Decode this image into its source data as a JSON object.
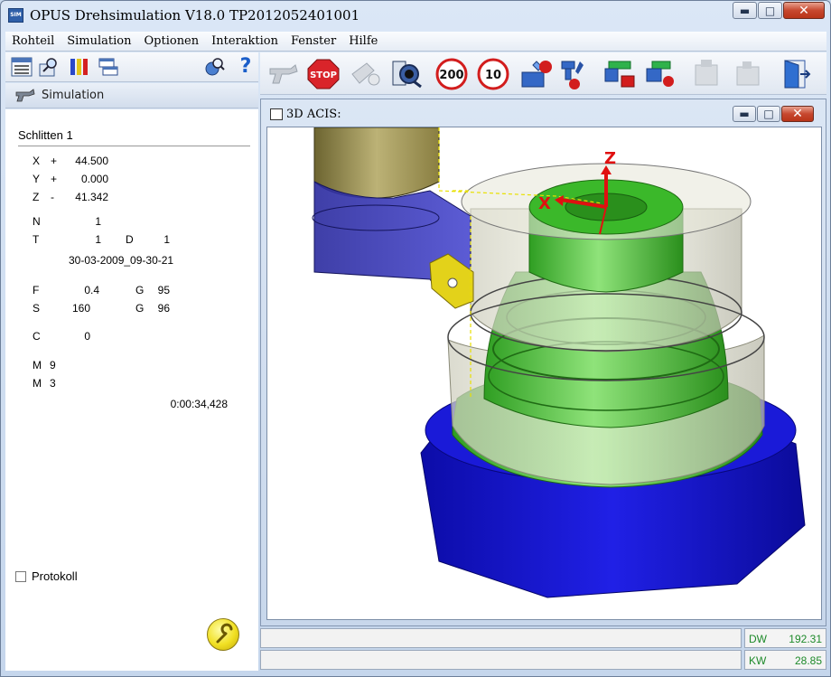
{
  "window": {
    "title": "OPUS Drehsimulation V18.0  TP2012052401001",
    "app_icon": "SIM"
  },
  "menu": [
    "Rohteil",
    "Simulation",
    "Optionen",
    "Interaktion",
    "Fenster",
    "Hilfe"
  ],
  "left_toolbar": {
    "icons": [
      "xyz-coordinates-icon",
      "tool-zoom-icon",
      "color-bars-icon",
      "windows-icon",
      "zoom-globe-icon",
      "help-icon"
    ],
    "help_glyph": "?"
  },
  "panel": {
    "header": "Simulation",
    "sled_title": "Schlitten 1",
    "x_label": "X",
    "x_sign": "+",
    "x_value": "44.500",
    "y_label": "Y",
    "y_sign": "+",
    "y_value": "0.000",
    "z_label": "Z",
    "z_sign": "-",
    "z_value": "41.342",
    "n_label": "N",
    "n_value": "1",
    "t_label": "T",
    "t_value": "1",
    "d_label": "D",
    "d_value": "1",
    "timestamp": "30-03-2009_09-30-21",
    "f_label": "F",
    "f_value": "0.4",
    "g1_label": "G",
    "g1_value": "95",
    "s_label": "S",
    "s_value": "160",
    "g2_label": "G",
    "g2_value": "96",
    "c_label": "C",
    "c_value": "0",
    "m1_label": "M",
    "m1_value": "9",
    "m2_label": "M",
    "m2_value": "3",
    "elapsed": "0:00:34,428",
    "protokoll_label": "Protokoll",
    "protokoll_checked": false
  },
  "main_toolbar": {
    "buttons": [
      "start-gun-icon",
      "stop-icon",
      "step-icon",
      "camera-icon",
      "speed-200-icon",
      "speed-10-icon",
      "tool-stop-icon",
      "tool-change-stop-icon",
      "collision-icon",
      "collision-check-icon",
      "machine-icon",
      "machine-disabled-icon",
      "exit-door-icon"
    ],
    "stop_label": "STOP",
    "speed_200": "200",
    "speed_10": "10"
  },
  "view": {
    "title": "3D ACIS:",
    "axis_x": "X",
    "axis_z": "Z",
    "colors": {
      "part": "#3fbf2a",
      "chuck": "#1515c8",
      "tool_holder": "#2a2aa8",
      "insert": "#e3d21a",
      "axis": "#e01010"
    }
  },
  "status": {
    "dw_label": "DW",
    "dw_value": "192.31",
    "kw_label": "KW",
    "kw_value": "28.85",
    "color": "#1e8a2a"
  }
}
